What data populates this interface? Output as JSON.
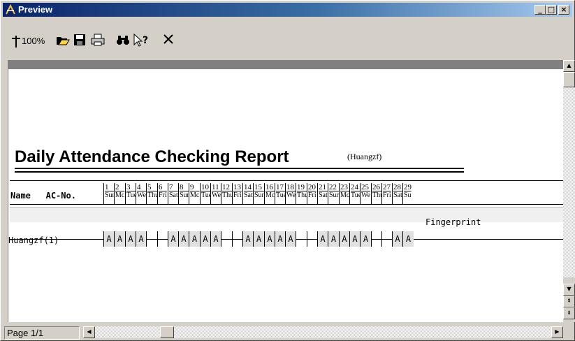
{
  "window": {
    "title": "Preview",
    "minimize": "_",
    "maximize": "□",
    "close": "×"
  },
  "toolbar": {
    "zoom_label": "100%",
    "items": [
      "zoom-tool",
      "open",
      "save",
      "print",
      "find",
      "help",
      "close"
    ]
  },
  "report": {
    "title": "Daily Attendance Checking Report",
    "user": "(Huangzf)",
    "columns": {
      "name": "Name",
      "ac": "AC-No."
    },
    "days": [
      {
        "n": "1",
        "w": "Sur"
      },
      {
        "n": "2",
        "w": "Mc"
      },
      {
        "n": "3",
        "w": "Tue"
      },
      {
        "n": "4",
        "w": "We"
      },
      {
        "n": "5",
        "w": "Thu"
      },
      {
        "n": "6",
        "w": "Fri"
      },
      {
        "n": "7",
        "w": "Sat"
      },
      {
        "n": "8",
        "w": "Sur"
      },
      {
        "n": "9",
        "w": "Mc"
      },
      {
        "n": "10",
        "w": "Tue"
      },
      {
        "n": "11",
        "w": "We"
      },
      {
        "n": "12",
        "w": "Thu"
      },
      {
        "n": "13",
        "w": "Fri"
      },
      {
        "n": "14",
        "w": "Sat"
      },
      {
        "n": "15",
        "w": "Sur"
      },
      {
        "n": "16",
        "w": "Mc"
      },
      {
        "n": "17",
        "w": "Tue"
      },
      {
        "n": "18",
        "w": "We"
      },
      {
        "n": "19",
        "w": "Thu"
      },
      {
        "n": "20",
        "w": "Fri"
      },
      {
        "n": "21",
        "w": "Sat"
      },
      {
        "n": "22",
        "w": "Sur"
      },
      {
        "n": "23",
        "w": "Mc"
      },
      {
        "n": "24",
        "w": "Tue"
      },
      {
        "n": "25",
        "w": "We"
      },
      {
        "n": "26",
        "w": "Thu"
      },
      {
        "n": "27",
        "w": "Fri"
      },
      {
        "n": "28",
        "w": "Sat"
      },
      {
        "n": "29",
        "w": "Su"
      }
    ],
    "section": "Fingerprint",
    "row_name": "Huangzf(1)",
    "cells": [
      "A",
      "A",
      "A",
      "A",
      "",
      "",
      "A",
      "A",
      "A",
      "A",
      "A",
      "",
      "",
      "A",
      "A",
      "A",
      "A",
      "A",
      "",
      "",
      "A",
      "A",
      "A",
      "A",
      "A",
      "",
      "",
      "A",
      "A"
    ]
  },
  "status": {
    "page": "Page 1/1"
  },
  "colors": {
    "titlebar": "#0a246a",
    "face": "#d4d0c8",
    "cell_on": "#e0e0e0"
  }
}
